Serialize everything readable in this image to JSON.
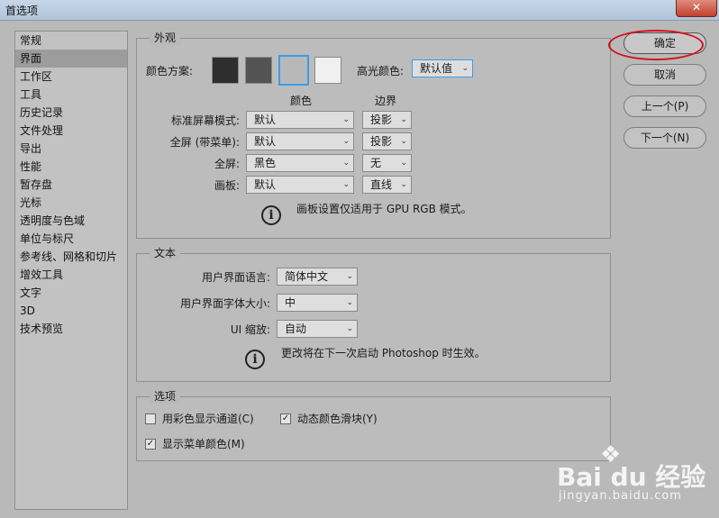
{
  "window": {
    "title": "首选项",
    "close_glyph": "✕"
  },
  "sidebar": {
    "items": [
      {
        "label": "常规",
        "active": false
      },
      {
        "label": "界面",
        "active": true
      },
      {
        "label": "工作区",
        "active": false
      },
      {
        "label": "工具",
        "active": false
      },
      {
        "label": "历史记录",
        "active": false
      },
      {
        "label": "文件处理",
        "active": false
      },
      {
        "label": "导出",
        "active": false
      },
      {
        "label": "性能",
        "active": false
      },
      {
        "label": "暂存盘",
        "active": false
      },
      {
        "label": "光标",
        "active": false
      },
      {
        "label": "透明度与色域",
        "active": false
      },
      {
        "label": "单位与标尺",
        "active": false
      },
      {
        "label": "参考线、网格和切片",
        "active": false
      },
      {
        "label": "增效工具",
        "active": false
      },
      {
        "label": "文字",
        "active": false
      },
      {
        "label": "3D",
        "active": false
      },
      {
        "label": "技术预览",
        "active": false
      }
    ]
  },
  "appearance": {
    "legend": "外观",
    "color_scheme_label": "颜色方案:",
    "swatches": [
      {
        "color": "#2e2e2e",
        "selected": false
      },
      {
        "color": "#535353",
        "selected": false
      },
      {
        "color": "#b8b8b8",
        "selected": true
      },
      {
        "color": "#f0f0f0",
        "selected": false
      }
    ],
    "highlight_label": "高光颜色:",
    "highlight_value": "默认值",
    "col_color_header": "颜色",
    "col_border_header": "边界",
    "rows": [
      {
        "label": "标准屏幕模式:",
        "color": "默认",
        "border": "投影"
      },
      {
        "label": "全屏 (带菜单):",
        "color": "默认",
        "border": "投影"
      },
      {
        "label": "全屏:",
        "color": "黑色",
        "border": "无"
      },
      {
        "label": "画板:",
        "color": "默认",
        "border": "直线"
      }
    ],
    "note": "画板设置仅适用于 GPU RGB 模式。"
  },
  "text_section": {
    "legend": "文本",
    "ui_language_label": "用户界面语言:",
    "ui_language_value": "简体中文",
    "ui_font_size_label": "用户界面字体大小:",
    "ui_font_size_value": "中",
    "ui_scale_label": "UI 缩放:",
    "ui_scale_value": "自动",
    "note": "更改将在下一次启动 Photoshop 时生效。"
  },
  "options": {
    "legend": "选项",
    "show_channels_color": {
      "label": "用彩色显示通道(C)",
      "checked": false
    },
    "dynamic_color_sliders": {
      "label": "动态颜色滑块(Y)",
      "checked": true
    },
    "show_menu_colors": {
      "label": "显示菜单颜色(M)",
      "checked": true
    }
  },
  "buttons": {
    "ok": "确定",
    "cancel": "取消",
    "prev": "上一个(P)",
    "next": "下一个(N)"
  },
  "icons": {
    "info": "i",
    "dropdown_arrow": "⌄",
    "check": "✓"
  },
  "watermark": {
    "paw": "❖",
    "brand": "Bai du 经验",
    "sub": "jingyan.baidu.com"
  },
  "colors": {
    "highlight_ring": "#d0121b",
    "selected_swatch_border": "#3d9be9"
  }
}
